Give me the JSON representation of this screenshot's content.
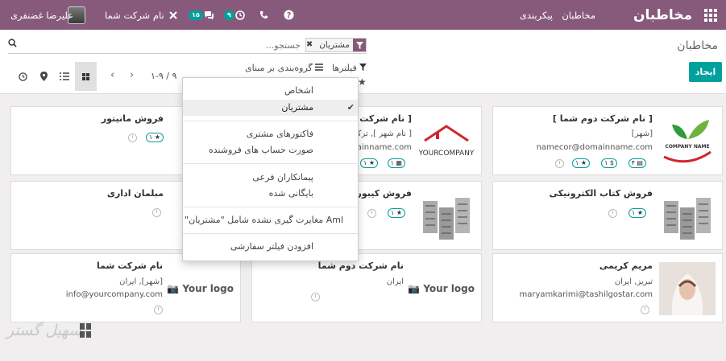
{
  "navbar": {
    "brand": "مخاطبان",
    "menu": [
      "مخاطبان",
      "پیکربندی"
    ],
    "company": "نام شرکت شما",
    "user": "علیرضا غضنفری",
    "activity_count": "۹",
    "messages_count": "۱۵",
    "bg_color": "#875a7b"
  },
  "control": {
    "breadcrumb": "مخاطبان",
    "create_label": "ایجاد",
    "search": {
      "placeholder": "جستجو...",
      "facet_value": "مشتریان",
      "facet_remove": "✖"
    },
    "filters_label": "فیلترها",
    "groupby_label": "گروه‌بندی بر مبنای",
    "pager": "۱-۹ / ۹",
    "pager_prev": "‹",
    "pager_next": "›"
  },
  "filter_dropdown": {
    "items": [
      {
        "label": "اشخاص",
        "selected": false
      },
      {
        "label": "مشتریان",
        "selected": true
      },
      {
        "label": "فاکتورهای مشتری",
        "selected": false
      },
      {
        "label": "صورت حساب های فروشنده",
        "selected": false
      },
      {
        "label": "پیمانکاران فرعی",
        "selected": false
      },
      {
        "label": "بایگانی شده",
        "selected": false
      },
      {
        "label": "Aml مغایرت گیری نشده شامل \"مشتریان\"",
        "selected": false
      },
      {
        "label": "افزودن فیلتر سفارشی",
        "selected": false
      }
    ]
  },
  "cards": [
    {
      "title": "[ نام شرکت دوم شما ]",
      "line1": "[شهر]",
      "email": "namecor@domainname.com",
      "tags": [
        "۴",
        "۱ $",
        "۱"
      ],
      "logo": "COMPANY NAME"
    },
    {
      "title": "[ نام شرکت ش",
      "line1": "[ نام شهر ], ترک",
      "email": "ainname.com",
      "tags": [
        "۱",
        "۱"
      ],
      "logo": "YOURCOMPANY"
    },
    {
      "title": "فروش مانیتور",
      "line1": "",
      "email": "",
      "tags": [
        "۱"
      ],
      "logo": ""
    },
    {
      "title": "فروش کتاب الکترونیکی",
      "line1": "",
      "email": "",
      "tags": [
        "۱"
      ],
      "logo": ""
    },
    {
      "title": "فروش کیبورد",
      "line1": "",
      "email": "",
      "tags": [
        "۱"
      ],
      "logo": ""
    },
    {
      "title": "مبلمان اداری",
      "line1": "",
      "email": "",
      "tags": [],
      "logo": ""
    },
    {
      "title": "مریم کریمی",
      "line1": "تبریز, ایران",
      "email": "maryamkarimi@tashilgostar.com",
      "tags": [],
      "logo": ""
    },
    {
      "title": "نام شرکت دوم شما",
      "line1": "ایران",
      "email": "",
      "tags": [],
      "logo": "Your logo"
    },
    {
      "title": "نام شرکت شما",
      "line1": "[شهر], ایران",
      "email": "info@yourcompany.com",
      "tags": [],
      "logo": "Your logo"
    }
  ],
  "watermark": "تسهیل گستر"
}
